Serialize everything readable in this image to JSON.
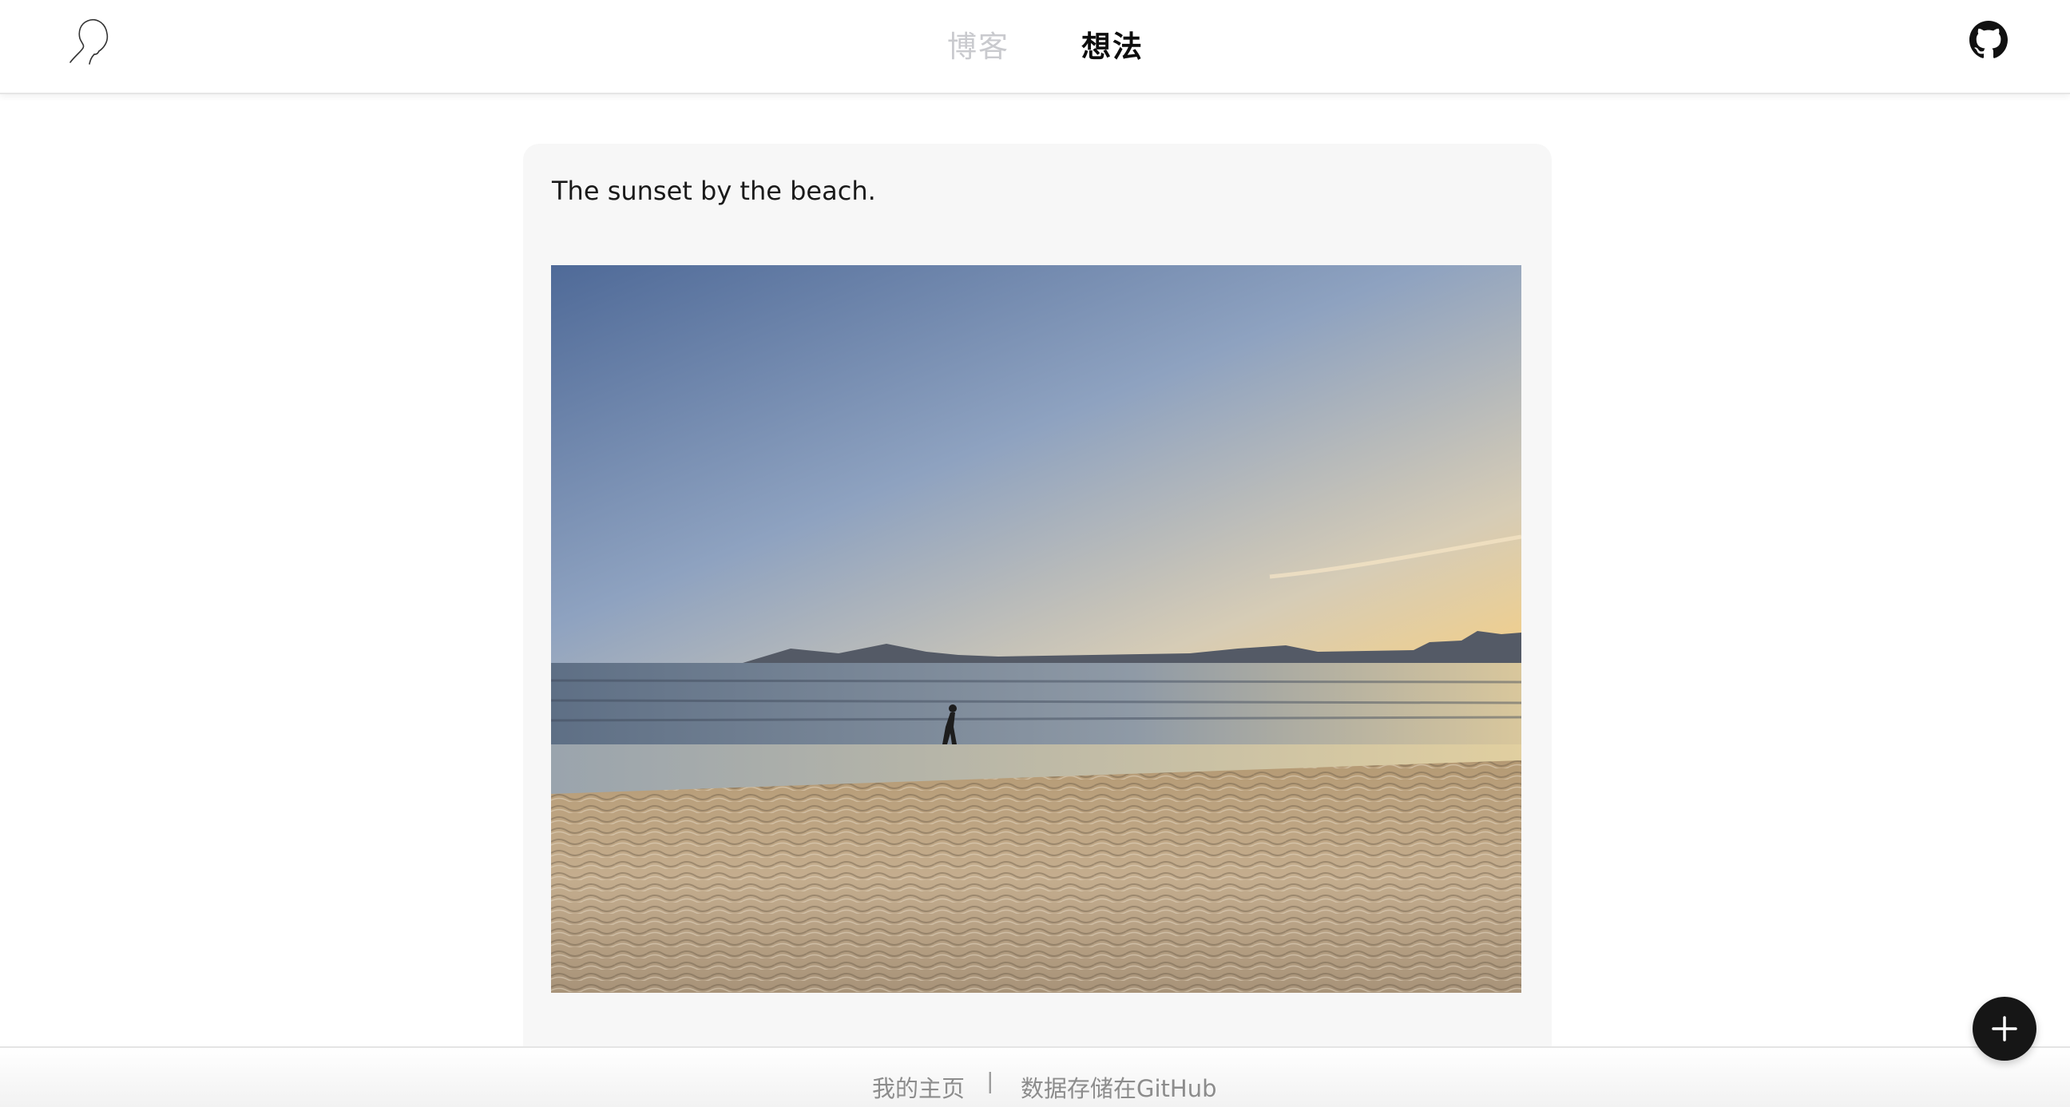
{
  "header": {
    "logo_icon": "profile-head-line-icon",
    "tabs": [
      {
        "label": "博客",
        "active": false
      },
      {
        "label": "想法",
        "active": true
      }
    ],
    "github_icon": "github-icon"
  },
  "post": {
    "text": "The sunset by the beach.",
    "image_description_icon": "beach-sunset-photo"
  },
  "footer": {
    "home_link": "我的主页",
    "separator": "|",
    "storage_link": "数据存储在GitHub"
  },
  "fab": {
    "icon": "plus-icon"
  },
  "colors": {
    "tab_inactive": "#c9cace",
    "tab_active": "#0d0d0d",
    "card_bg": "#f7f7f7",
    "fab_bg": "#161616",
    "footer_text": "#8c8c8c"
  }
}
